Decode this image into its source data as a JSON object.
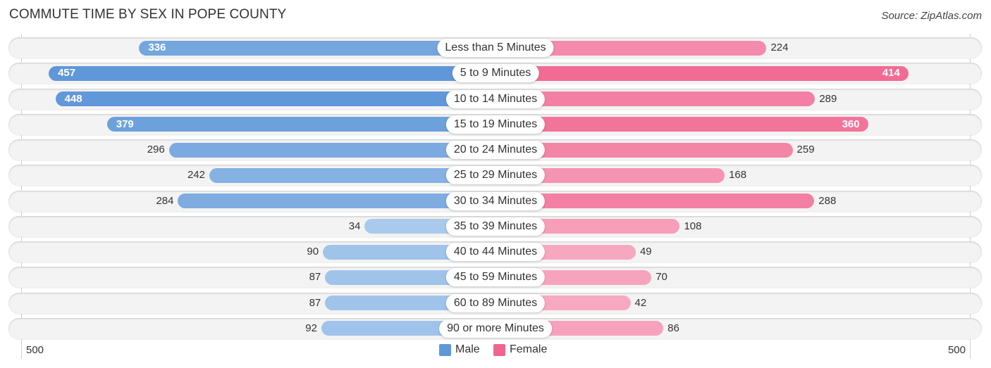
{
  "header": {
    "title": "COMMUTE TIME BY SEX IN POPE COUNTY",
    "source": "Source: ZipAtlas.com"
  },
  "legend": {
    "male": "Male",
    "female": "Female"
  },
  "axis": {
    "left_label": "500",
    "right_label": "500"
  },
  "colors": {
    "male_dark": "#5f97d8",
    "male_light": "#aacaed",
    "female_dark": "#f0638f",
    "female_light": "#f7abc3",
    "legend_male": "#5f98d8",
    "legend_female": "#f0648f",
    "row_background": "#f3f3f3"
  },
  "chart_data": {
    "type": "bar",
    "orientation": "horizontal-diverging",
    "title": "COMMUTE TIME BY SEX IN POPE COUNTY",
    "xlabel": "",
    "ylabel": "",
    "xlim": [
      0,
      500
    ],
    "legend": [
      "Male",
      "Female"
    ],
    "legend_position": "bottom-center",
    "grid": false,
    "categories": [
      "Less than 5 Minutes",
      "5 to 9 Minutes",
      "10 to 14 Minutes",
      "15 to 19 Minutes",
      "20 to 24 Minutes",
      "25 to 29 Minutes",
      "30 to 34 Minutes",
      "35 to 39 Minutes",
      "40 to 44 Minutes",
      "45 to 59 Minutes",
      "60 to 89 Minutes",
      "90 or more Minutes"
    ],
    "series": [
      {
        "name": "Male",
        "side": "left",
        "values": [
          336,
          457,
          448,
          379,
          296,
          242,
          284,
          34,
          90,
          87,
          87,
          92
        ]
      },
      {
        "name": "Female",
        "side": "right",
        "values": [
          224,
          414,
          289,
          360,
          259,
          168,
          288,
          108,
          49,
          70,
          42,
          86
        ]
      }
    ],
    "tick_labels": {
      "left": "500",
      "right": "500"
    }
  }
}
